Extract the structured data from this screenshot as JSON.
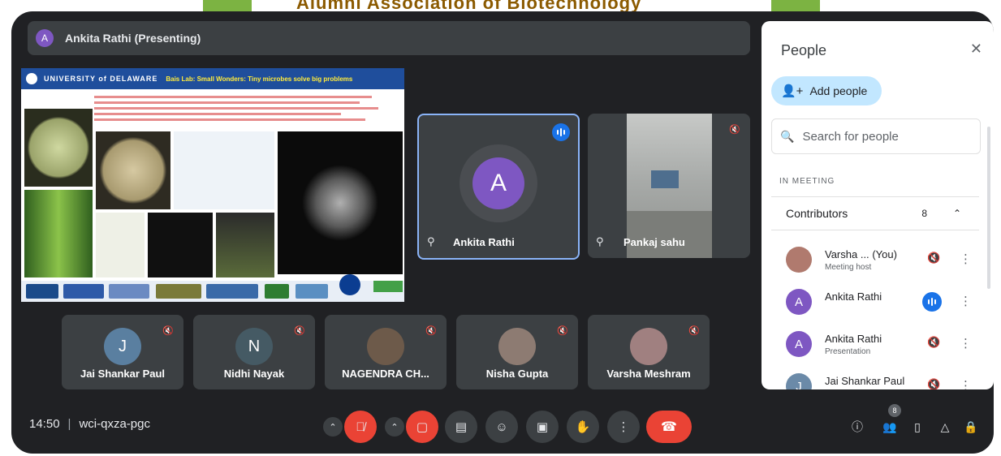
{
  "banner": {
    "text": "Alumni Association of Biotechnology"
  },
  "presenter_bar": {
    "avatar_letter": "A",
    "title": "Ankita Rathi (Presenting)"
  },
  "slide": {
    "university": "UNIVERSITY of DELAWARE",
    "tagline": "Bais Lab: Small Wonders: Tiny microbes solve big problems"
  },
  "tiles": [
    {
      "name": "Ankita Rathi",
      "avatar_letter": "A"
    },
    {
      "name": "Pankaj sahu"
    }
  ],
  "small_tiles": [
    {
      "name": "Jai Shankar Paul",
      "avatar_letter": "J",
      "color": "#5a7fa0"
    },
    {
      "name": "Nidhi Nayak",
      "avatar_letter": "N",
      "color": "#455a64"
    },
    {
      "name": "NAGENDRA CH...",
      "avatar_letter": "",
      "color": "#6d5a4a"
    },
    {
      "name": "Nisha Gupta",
      "avatar_letter": "",
      "color": "#8d7b72"
    },
    {
      "name": "Varsha Meshram",
      "avatar_letter": "",
      "color": "#a08080"
    }
  ],
  "bottom_bar": {
    "time": "14:50",
    "meeting_code": "wci-qxza-pgc",
    "people_count": "8"
  },
  "people_panel": {
    "title": "People",
    "add_people": "Add people",
    "search_placeholder": "Search for people",
    "section": "IN MEETING",
    "contributors_label": "Contributors",
    "contributors_count": "8",
    "participants": [
      {
        "name": "Varsha ...",
        "suffix": "(You)",
        "sub": "Meeting host",
        "avatar_letter": "",
        "color": "#b07a6e"
      },
      {
        "name": "Ankita Rathi",
        "suffix": "",
        "sub": "",
        "avatar_letter": "A",
        "color": "#7e57c2"
      },
      {
        "name": "Ankita Rathi",
        "suffix": "",
        "sub": "Presentation",
        "avatar_letter": "A",
        "color": "#7e57c2"
      },
      {
        "name": "Jai Shankar Paul",
        "suffix": "",
        "sub": "",
        "avatar_letter": "J",
        "color": "#6b8aa8"
      }
    ]
  },
  "colors": {
    "meet_bg": "#202124",
    "tile_bg": "#3c4043",
    "accent_blue": "#1a73e8",
    "danger_red": "#ea4335",
    "chip_blue": "#c2e7ff"
  }
}
